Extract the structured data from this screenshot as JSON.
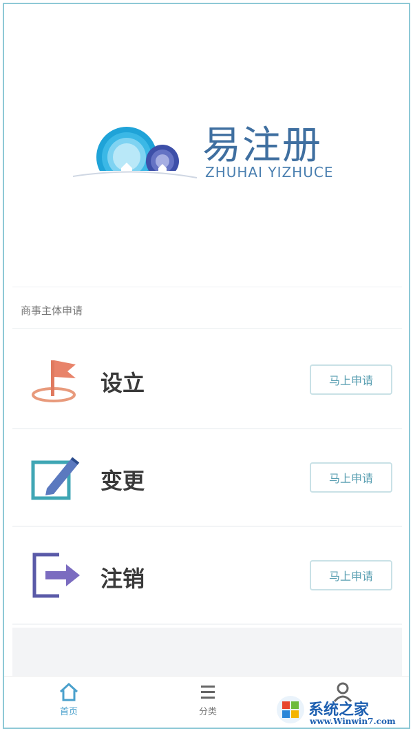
{
  "brand": {
    "title": "易注册",
    "subtitle": "ZHUHAI YIZHUCE",
    "colors": {
      "primary": "#3f6fa0",
      "accent": "#4aa0cc"
    }
  },
  "section": {
    "label": "商事主体申请"
  },
  "items": [
    {
      "icon": "flag-icon",
      "title": "设立",
      "button": "马上申请"
    },
    {
      "icon": "edit-icon",
      "title": "变更",
      "button": "马上申请"
    },
    {
      "icon": "exit-icon",
      "title": "注销",
      "button": "马上申请"
    }
  ],
  "tabs": [
    {
      "icon": "home-icon",
      "label": "首页",
      "active": true
    },
    {
      "icon": "menu-icon",
      "label": "分类",
      "active": false
    },
    {
      "icon": "user-icon",
      "label": "",
      "active": false
    }
  ],
  "watermark": {
    "text": "系统之家",
    "url": "www.Winwin7.com"
  }
}
